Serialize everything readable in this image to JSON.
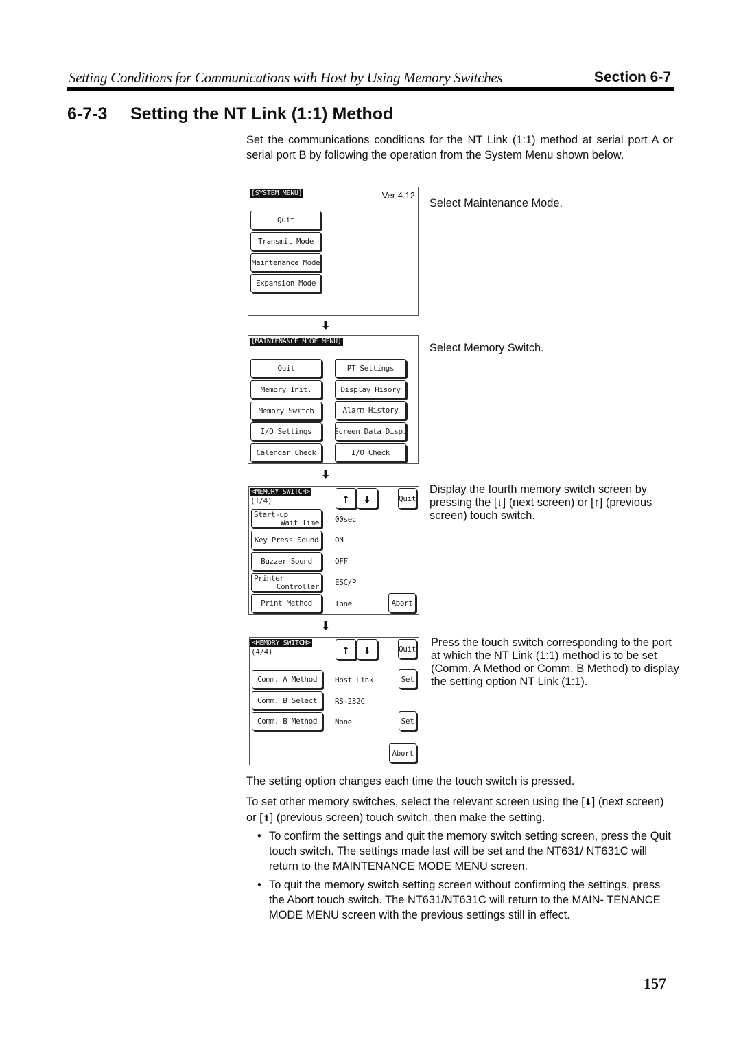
{
  "header": {
    "running_title": "Setting Conditions for Communications with Host by Using Memory Switches",
    "section_label": "Section 6-7"
  },
  "heading": {
    "number": "6-7-3",
    "title": "Setting the NT Link (1:1) Method"
  },
  "intro": "Set the communications conditions for the NT Link (1:1) method at serial port A or serial port B by following the operation from the System Menu shown below.",
  "screens": {
    "system_menu": {
      "tag": "[SYSTEM MENU]",
      "version": "Ver 4.12",
      "buttons": [
        "Quit",
        "Transmit Mode",
        "Maintenance Mode",
        "Expansion Mode"
      ],
      "caption": "Select Maintenance Mode."
    },
    "maintenance_menu": {
      "tag": "[MAINTENANCE MODE MENU]",
      "left_buttons": [
        "Quit",
        "Memory Init.",
        "Memory Switch",
        "I/O Settings",
        "Calendar Check"
      ],
      "right_buttons": [
        "PT Settings",
        "Display Hisory",
        "Alarm History",
        "Screen Data Disp.",
        "I/O Check"
      ],
      "caption": "Select Memory Switch."
    },
    "memory_switch_1": {
      "tag": "<MEMORY SWITCH>",
      "page": "(1/4)",
      "up_icon": "↑",
      "down_icon": "↓",
      "quit": "Quit",
      "abort": "Abort",
      "rows": [
        {
          "label1": "Start-up",
          "label2": "Wait Time",
          "value": "00sec"
        },
        {
          "label1": "Key Press Sound",
          "label2": "",
          "value": "ON"
        },
        {
          "label1": "Buzzer Sound",
          "label2": "",
          "value": "OFF"
        },
        {
          "label1": "Printer",
          "label2": "Controller",
          "value": "ESC/P"
        },
        {
          "label1": "Print Method",
          "label2": "",
          "value": "Tone"
        }
      ],
      "caption": "Display the fourth memory switch screen by pressing the [↓] (next screen) or [↑] (previous screen) touch switch."
    },
    "memory_switch_4": {
      "tag": "<MEMORY SWITCH>",
      "page": "(4/4)",
      "up_icon": "↑",
      "down_icon": "↓",
      "quit": "Quit",
      "abort": "Abort",
      "set": "Set",
      "rows": [
        {
          "label": "Comm. A Method",
          "value": "Host Link"
        },
        {
          "label": "Comm. B Select",
          "value": "RS-232C"
        },
        {
          "label": "Comm. B Method",
          "value": "None"
        }
      ],
      "caption": "Press the touch switch corresponding to the port at which the NT Link (1:1) method is to be set (Comm. A Method or Comm. B Method) to display the setting option NT Link (1:1)."
    }
  },
  "flow_arrow": "⬇",
  "body": {
    "p1": "The setting option changes each time the touch switch is pressed.",
    "p2_a": "To set other memory switches, select the relevant screen using the [",
    "p2_down": "⬇",
    "p2_b": "] (next screen) or [",
    "p2_up": "⬆",
    "p2_c": "] (previous screen) touch switch, then make the setting.",
    "bullets": [
      "To confirm the settings and quit the memory switch setting screen, press the Quit touch switch. The settings made last will be set and the NT631/ NT631C will return to the MAINTENANCE MODE MENU screen.",
      "To quit the memory switch setting screen without confirming the settings, press the Abort touch switch. The NT631/NT631C will return to the MAIN- TENANCE MODE MENU screen with the previous settings still in effect."
    ],
    "bullet_char": "•"
  },
  "page_number": "157"
}
